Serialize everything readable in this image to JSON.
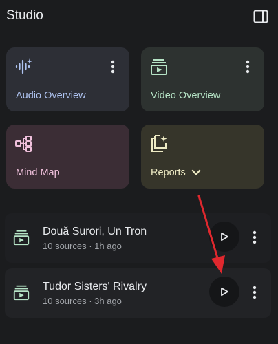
{
  "header": {
    "title": "Studio",
    "toggle_icon": "side-panel-icon"
  },
  "cards": {
    "audio": {
      "label": "Audio Overview",
      "icon": "waveform-sparkle-icon",
      "accent": "#aec3f0"
    },
    "video": {
      "label": "Video Overview",
      "icon": "video-slides-icon",
      "accent": "#b6e4c6"
    },
    "mind_map": {
      "label": "Mind Map",
      "icon": "mind-map-icon",
      "accent": "#f0c0dc"
    },
    "reports": {
      "label": "Reports",
      "icon": "reports-sparkle-icon",
      "accent": "#eeebc4"
    }
  },
  "items": [
    {
      "title": "Două Surori, Un Tron",
      "meta": "10 sources · 1h ago",
      "icon": "video-slides-icon"
    },
    {
      "title": "Tudor Sisters' Rivalry",
      "meta": "10 sources · 3h ago",
      "icon": "video-slides-icon"
    }
  ],
  "annotation": {
    "color": "#e0282e"
  }
}
